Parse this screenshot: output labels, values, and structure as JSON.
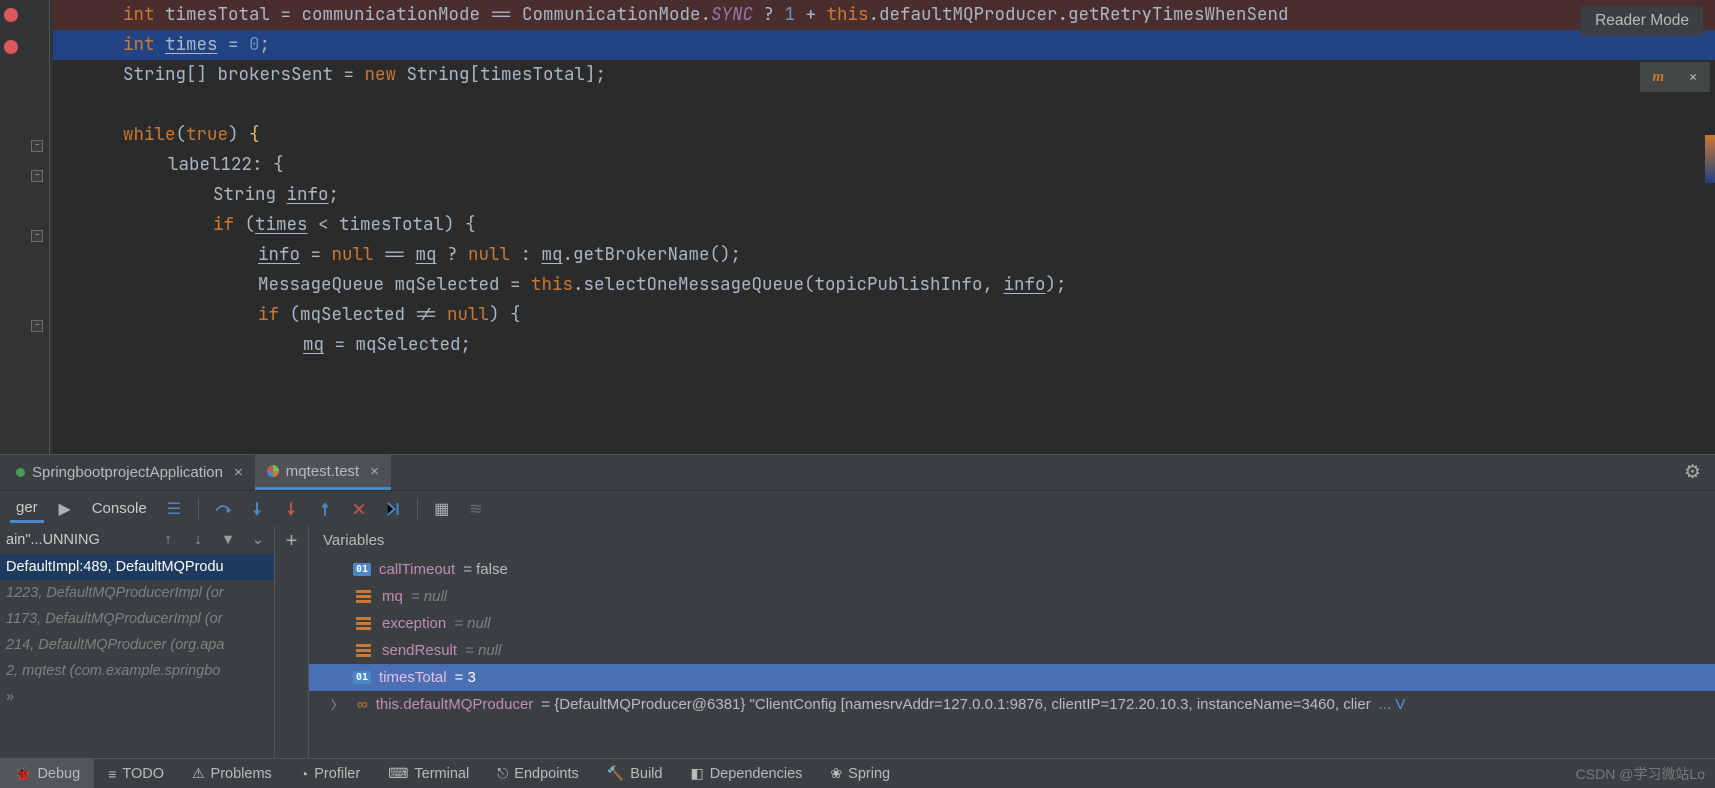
{
  "reader_mode": "Reader Mode",
  "code": {
    "l1a": "int",
    "l1b": " timesTotal = communicationMode == CommunicationMode.",
    "l1c": "SYNC",
    "l1d": " ? ",
    "l1e": "1",
    "l1f": " + ",
    "l1g": "this",
    "l1h": ".defaultMQProducer.getRetryTimesWhenSend",
    "l2a": "int ",
    "l2b": "times",
    "l2c": " = ",
    "l2d": "0",
    "l2e": ";",
    "l3": "String[] brokersSent = ",
    "l3a": "new",
    "l3b": " String[timesTotal];",
    "l4a": "while",
    "l4b": "(",
    "l4c": "true",
    "l4d": ") ",
    "l4e": "{",
    "l5": "label122: {",
    "l6": "String ",
    "l6a": "info",
    "l6b": ";",
    "l7a": "if",
    "l7b": " (",
    "l7c": "times",
    "l7d": " < timesTotal) {",
    "l8a": "info",
    "l8b": " = ",
    "l8c": "null",
    "l8d": " == ",
    "l8e": "mq",
    "l8f": " ? ",
    "l8g": "null",
    "l8h": " : ",
    "l8i": "mq",
    "l8j": ".getBrokerName();",
    "l9a": "MessageQueue mqSelected = ",
    "l9b": "this",
    "l9c": ".selectOneMessageQueue(topicPublishInfo, ",
    "l9d": "info",
    "l9e": ");",
    "l10a": "if",
    "l10b": " (mqSelected != ",
    "l10c": "null",
    "l10d": ") {",
    "l11a": "mq",
    "l11b": " = mqSelected;"
  },
  "run_tabs": {
    "t1": "SpringbootprojectApplication",
    "t2": "mqtest.test"
  },
  "dbg_toolbar": {
    "debugger": "ger",
    "console": "Console"
  },
  "frames": {
    "header": "ain\"...UNNING",
    "rows": [
      "DefaultImpl:489, DefaultMQProdu",
      "1223, DefaultMQProducerImpl (or",
      "1173, DefaultMQProducerImpl (or",
      "214, DefaultMQProducer (org.apa",
      "2, mqtest (com.example.springbo"
    ]
  },
  "vars_header": "Variables",
  "vars": [
    {
      "type": "01",
      "name": "callTimeout",
      "val": " = false"
    },
    {
      "type": "f",
      "name": "mq",
      "val": " = null",
      "null": true
    },
    {
      "type": "f",
      "name": "exception",
      "val": " = null",
      "null": true
    },
    {
      "type": "f",
      "name": "sendResult",
      "val": " = null",
      "null": true
    },
    {
      "type": "01",
      "name": "timesTotal",
      "val": " = 3",
      "sel": true
    },
    {
      "type": "obj",
      "name": "this.defaultMQProducer",
      "val": " = {DefaultMQProducer@6381} \"ClientConfig [namesrvAddr=127.0.0.1:9876, clientIP=172.20.10.3, instanceName=3460, clier",
      "chev": true,
      "more": "...  V"
    }
  ],
  "bottom": [
    {
      "label": "Debug",
      "active": true
    },
    {
      "label": "TODO"
    },
    {
      "label": "Problems"
    },
    {
      "label": "Profiler"
    },
    {
      "label": "Terminal"
    },
    {
      "label": "Endpoints"
    },
    {
      "label": "Build"
    },
    {
      "label": "Dependencies"
    },
    {
      "label": "Spring"
    }
  ],
  "watermark": "CSDN @学习微站Lo"
}
